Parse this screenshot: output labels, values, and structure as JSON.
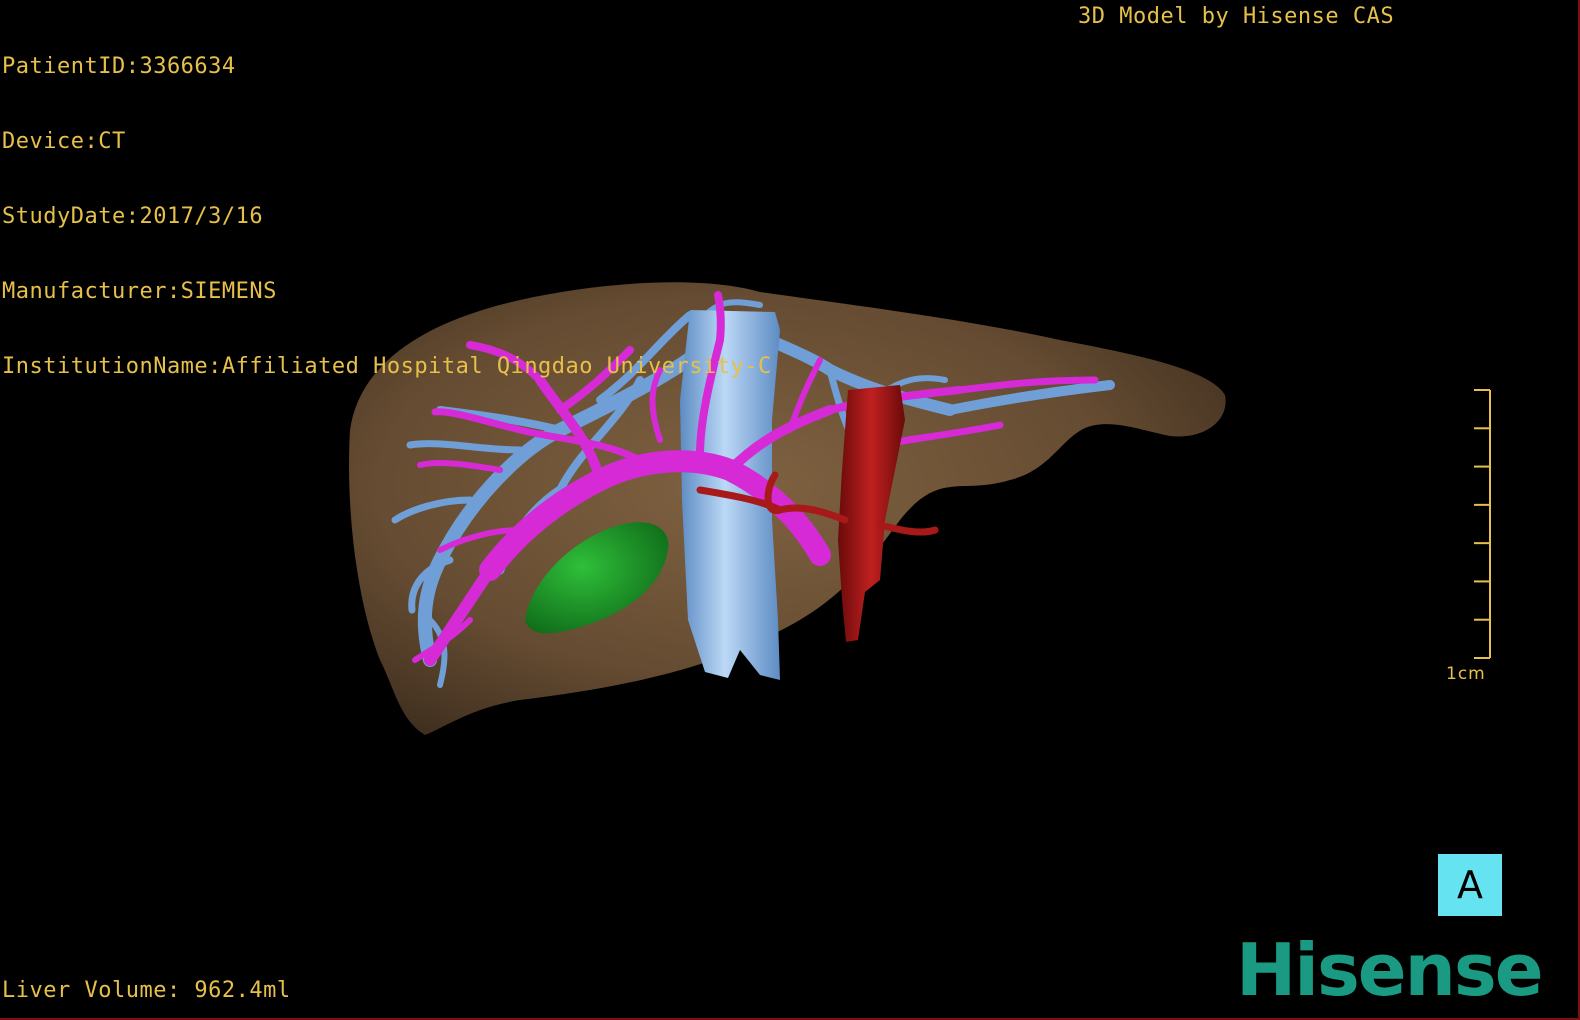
{
  "patient_info": {
    "patient_id": "PatientID:3366634",
    "device": "Device:CT",
    "study_date": "StudyDate:2017/3/16",
    "manufacturer": "Manufacturer:SIEMENS",
    "institution": "InstitutionName:Affiliated Hospital Qingdao University-C"
  },
  "model_credit": "3D Model by Hisense CAS",
  "liver_volume": "Liver Volume: 962.4ml",
  "scale_bar": {
    "label": "1cm",
    "divisions": 7
  },
  "orientation_label": "A",
  "brand": "Hisense",
  "colors": {
    "overlay_text": "#e6c04a",
    "liver": "#7a5a3a",
    "hepatic_vein": "#6f9fd6",
    "portal_vein": "#d62ad6",
    "artery": "#b01818",
    "gallbladder": "#1f9a2a",
    "badge": "#66e3f0",
    "brand": "#1a9a83"
  },
  "structures": {
    "liver": "liver-model",
    "hepatic_vein": "hepatic-vein-model",
    "portal_vein": "portal-vein-model",
    "artery": "hepatic-artery-model",
    "gallbladder": "gallbladder-model"
  }
}
